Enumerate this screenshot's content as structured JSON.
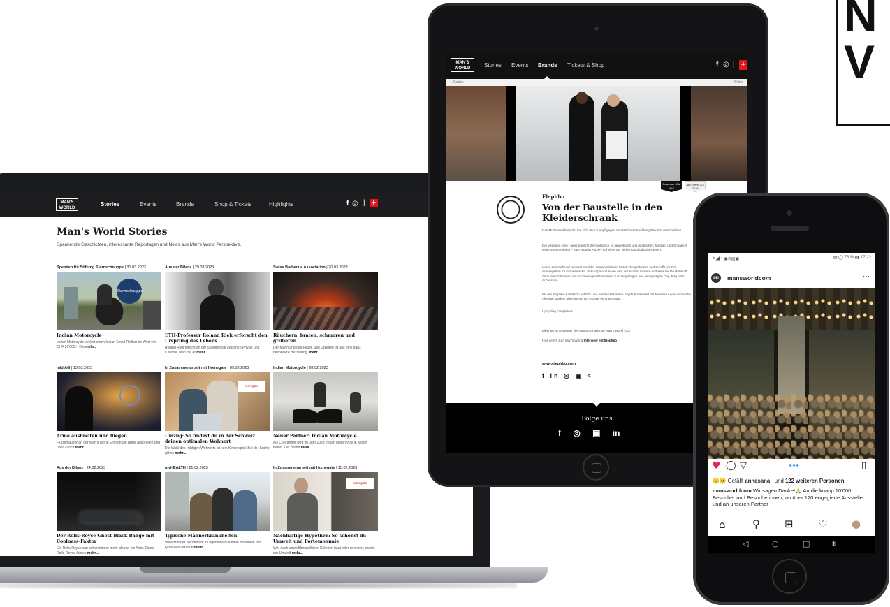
{
  "corner_logo": {
    "text": "MW"
  },
  "laptop": {
    "nav": {
      "logo": "MAN'S WORLD",
      "items": [
        "Stories",
        "Events",
        "Brands",
        "Shop & Tickets",
        "Highlights"
      ],
      "active_index": 0,
      "social": [
        "f",
        "◎",
        "|"
      ],
      "flag": "+"
    },
    "page_title": "Man's World Stories",
    "page_subtitle": "Spannende Geschichten, interessante Reportagen und News aus Man's World Perspektive.",
    "cards": [
      {
        "meta_bold": "Spenden für Stiftung Sternschnuppe",
        "meta_date": " | 31.03.2023",
        "title": "Indian Motorcycle",
        "text": "Indian Motorcycle verlost einen Indian Scout Rollbar im Wert von CHF 20'000.-. Die",
        "more": "mehr..."
      },
      {
        "meta_bold": "Aus der Bilanz",
        "meta_date": " | 29.03.2023",
        "title": "ETH-Professor Roland Riek erforscht den Ursprung des Lebens",
        "text": "Roland Riek forscht an der Schnittstelle zwischen Physik und Chemie. Man hat er",
        "more": "mehr..."
      },
      {
        "meta_bold": "Swiss Barbecue Association",
        "meta_date": " | 20.03.2023",
        "title": "Räuchern, braten, schmoren und grillieren",
        "text": "Der Mann und das Feuer. Seit Urzeiten ist das eine ganz besondere Beziehung.",
        "more": "mehr..."
      },
      {
        "meta_bold": "mld AG",
        "meta_date": " | 13.03.2023",
        "title": "Arme ausbreiten und fliegen",
        "text": "Flugsimulator an der Man's World Einfach die Arme ausbreiten und über Zürich",
        "more": "mehr..."
      },
      {
        "meta_bold": "In Zusammenarbeit mit Homegate",
        "meta_date": " | 09.03.2023",
        "title": "Umzug: So findest du in der Schweiz deinen optimalen Wohnort",
        "text": "Die Wahl des richtigen Wohnorts ist kein Kinderspiel. Bei der Suche gilt es",
        "more": "mehr..."
      },
      {
        "meta_bold": "Indian Motorcycle",
        "meta_date": " | 28.02.2023",
        "title": "Neuer Partner: Indian Motorcycle",
        "text": "Als Co-Partner wird im Jahr 2023 Indian Motorcycle in Aktion treten. Der Brand",
        "more": "mehr..."
      },
      {
        "meta_bold": "Aus der Bilanz",
        "meta_date": " | 24.02.2023",
        "title": "Der Rolls-Royce Ghost Black Badge mit Coolness-Faktor",
        "text": "Ein Rolls-Royce war schon immer mehr als nur ein Auto. Einen Rolls-Royce fahren",
        "more": "mehr..."
      },
      {
        "meta_bold": "myHEALTH",
        "meta_date": " | 21.02.2023",
        "title": "Typische Männerkrankheiten",
        "text": "Viele Männer bekommen es irgendwann einmal mit einem der typischen «Männe",
        "more": "mehr..."
      },
      {
        "meta_bold": "In Zusammenarbeit mit Homegate",
        "meta_date": " | 15.02.2023",
        "title": "Nachhaltige Hypothek: So schonst du Umwelt und Portemonnaie",
        "text": "Wer nach umweltfreundlichen Kriterien baut oder renoviert, macht der Umwelt",
        "more": "mehr..."
      }
    ]
  },
  "tablet": {
    "nav": {
      "logo": "MAN'S WORLD",
      "items": [
        "Stories",
        "Events",
        "Brands",
        "Tickets & Shop"
      ],
      "active_index": 2,
      "social": [
        "f",
        "◎",
        "|"
      ],
      "flag": "+"
    },
    "back": "‹ Zurück",
    "next": "Weiter",
    "badges": [
      "Gewinner MW GO!",
      "Am Event: 2/3 2019"
    ],
    "brand": "Elephbo",
    "title": "Von der Baustelle in den Kleiderschrank",
    "paragraphs": [
      "Das Modelabel Elephbo hat sich dem Kampf gegen den Müll in Entwicklungsländern verschrieben.",
      "Die visionäre Idee – ausrangierte Zementsäcke zu langlebigen und modischen Taschen und Sneakers weiterzuverarbeiten – kam Nicolas Huxley auf einer der vielen Kambodscha-Reisen.",
      "Heute sammelt und recycelt Elephbo Zementsäcke in Entwicklungsländern und schafft vor Ort Arbeitsplätze für Einheimische. In Europa und Asien wird der extrem robuste und sehr leichte Rohstoff dann in Kombination mit hochwertigen Materialien zum langlebigen und einzigartigen Cap, Bag oder Accessoire.",
      "Mit der Elephbo-Kollektion setzt Du mit ausdrucksstarken Sujets kombiniert mit feinstem Leder modische Akzente. Zudem übernimmst Du soziale Verantwortung.",
      "Upcycling completed!",
      "Elephbo ist Gewinner der Startup Challenge Man's World GO!"
    ],
    "link_prefix": "Hier geht's zum Man's World ",
    "link_bold": "Interview mit Elephbo",
    "website": "www.elephbo.com",
    "brand_icons": "f in ◎ ▣ <",
    "footer_title": "Folge uns",
    "footer_icons": "f ◎ ▣ in"
  },
  "phone": {
    "status_left": "ㅊ◢ ⁿ ▣⊘▤▣",
    "status_right": "▤|◯ 75 % ▮▮ 17:22",
    "avatar": "DEJ",
    "username": "mansworldcom",
    "more": "···",
    "actions": {
      "like": "♥",
      "comment": "◯",
      "share": "▽",
      "save": "▯"
    },
    "likes_prefix": "🙂🙂 Gefällt ",
    "likes_user": "annasana_",
    "likes_mid": " und ",
    "likes_count": "122 weiteren Personen",
    "caption_user": "mansworldcom",
    "caption_text": " Wir sagen Danke!🙏 An die knapp 10'000 Besucher und Besucherinnen, an über 120 engagierte Aussteller und an unseren Partner",
    "tabs": [
      "⌂",
      "⚲",
      "⊞",
      "♡",
      "●"
    ],
    "android": [
      "◁",
      "○",
      "□",
      "⇟"
    ]
  }
}
